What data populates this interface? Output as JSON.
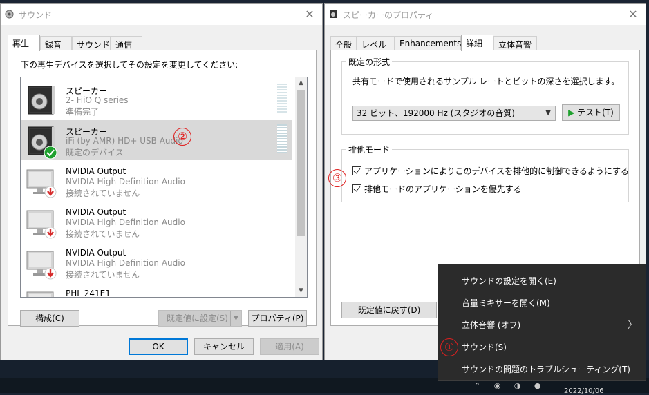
{
  "sound_window": {
    "title": "サウンド",
    "tabs": [
      "再生",
      "録音",
      "サウンド",
      "通信"
    ],
    "instruction": "下の再生デバイスを選択してその設定を変更してください:",
    "devices": [
      {
        "name": "スピーカー",
        "sub": "2- FiiO Q series",
        "status": "準備完了"
      },
      {
        "name": "スピーカー",
        "sub": "iFi (by AMR) HD+ USB Audio",
        "status": "既定のデバイス"
      },
      {
        "name": "NVIDIA Output",
        "sub": "NVIDIA High Definition Audio",
        "status": "接続されていません"
      },
      {
        "name": "NVIDIA Output",
        "sub": "NVIDIA High Definition Audio",
        "status": "接続されていません"
      },
      {
        "name": "NVIDIA Output",
        "sub": "NVIDIA High Definition Audio",
        "status": "接続されていません"
      },
      {
        "name": "PHL 241E1",
        "sub": "",
        "status": ""
      }
    ],
    "configure_label": "構成(C)",
    "set_default_label": "既定値に設定(S)",
    "properties_label": "プロパティ(P)",
    "ok_label": "OK",
    "cancel_label": "キャンセル",
    "apply_label": "適用(A)"
  },
  "props_window": {
    "title": "スピーカーのプロパティ",
    "tabs": [
      "全般",
      "レベル",
      "Enhancements",
      "詳細",
      "立体音響"
    ],
    "default_format_label": "既定の形式",
    "default_format_desc": "共有モードで使用されるサンプル レートとビットの深さを選択します。",
    "format_value": "32 ビット、192000 Hz (スタジオの音質)",
    "test_label": "テスト(T)",
    "exclusive_label": "排他モード",
    "exclusive_option1": "アプリケーションによりこのデバイスを排他的に制御できるようにする",
    "exclusive_option2": "排他モードのアプリケーションを優先する",
    "restore_defaults_label": "既定値に戻す(D)"
  },
  "context_menu": {
    "items": [
      "サウンドの設定を開く(E)",
      "音量ミキサーを開く(M)",
      "立体音響 (オフ)",
      "サウンド(S)",
      "サウンドの問題のトラブルシューティング(T)"
    ]
  },
  "annotations": [
    "①",
    "②",
    "③"
  ],
  "taskbar": {
    "date": "2022/10/06"
  },
  "colors": {
    "accent": "#0078d7",
    "annotation": "#e02020",
    "check_green": "#1fa12f",
    "unplug_red": "#d62b2b",
    "menu_bg": "#2b2b2b"
  }
}
